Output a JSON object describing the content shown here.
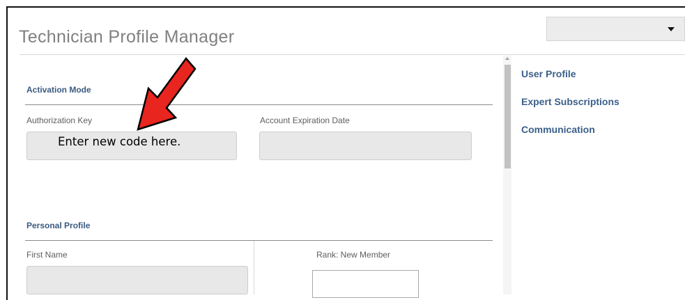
{
  "app": {
    "title": "Technician Profile Manager"
  },
  "top_select": {
    "value": ""
  },
  "activation": {
    "heading": "Activation Mode",
    "authorization_key": {
      "label": "Authorization Key",
      "value": ""
    },
    "account_expiration": {
      "label": "Account Expiration Date",
      "value": ""
    }
  },
  "annotation": {
    "text": "Enter new code here.",
    "arrow_color": "#e8251f"
  },
  "personal": {
    "heading": "Personal Profile",
    "first_name": {
      "label": "First Name",
      "value": ""
    },
    "rank_label": "Rank: New Member"
  },
  "side_nav": {
    "items": [
      {
        "label": "User Profile"
      },
      {
        "label": "Expert Subscriptions"
      },
      {
        "label": "Communication"
      }
    ]
  },
  "icons": {
    "dropdown": "chevron-down-icon",
    "scroll_up": "scroll-up-arrow-icon",
    "callout": "arrow-callout-icon"
  },
  "colors": {
    "accent_text": "#3b5f8a",
    "field_fill": "#e8e8e8"
  }
}
